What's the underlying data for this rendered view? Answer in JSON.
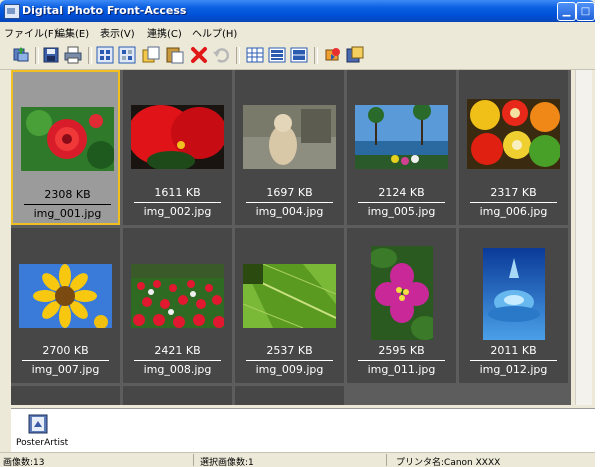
{
  "window": {
    "title": "Digital Photo Front-Access"
  },
  "menu": [
    "ファイル(F)",
    "編集(E)",
    "表示(V)",
    "連携(C)",
    "ヘルプ(H)"
  ],
  "toolbar_icons": [
    "import-icon",
    "save-icon",
    "print-icon",
    "select-all-icon",
    "select-icon",
    "copy-icon",
    "paste-icon",
    "delete-icon",
    "undo-icon",
    "view-small-icon",
    "view-medium-icon",
    "view-large-icon",
    "slideshow-icon",
    "send-icon"
  ],
  "images": [
    {
      "size": "2308 KB",
      "name": "img_001.jpg",
      "selected": true
    },
    {
      "size": "1611 KB",
      "name": "img_002.jpg"
    },
    {
      "size": "1697 KB",
      "name": "img_004.jpg"
    },
    {
      "size": "2124 KB",
      "name": "img_005.jpg"
    },
    {
      "size": "2317 KB",
      "name": "img_006.jpg"
    },
    {
      "size": "2700 KB",
      "name": "img_007.jpg"
    },
    {
      "size": "2421 KB",
      "name": "img_008.jpg"
    },
    {
      "size": "2537 KB",
      "name": "img_009.jpg"
    },
    {
      "size": "2595 KB",
      "name": "img_011.jpg"
    },
    {
      "size": "2011 KB",
      "name": "img_012.jpg"
    }
  ],
  "panel": {
    "app_label": "PosterArtist"
  },
  "status": {
    "image_count": "画像数:13",
    "selected_count": "選択画像数:1",
    "printer": "プリンタ名:Canon XXXX"
  }
}
